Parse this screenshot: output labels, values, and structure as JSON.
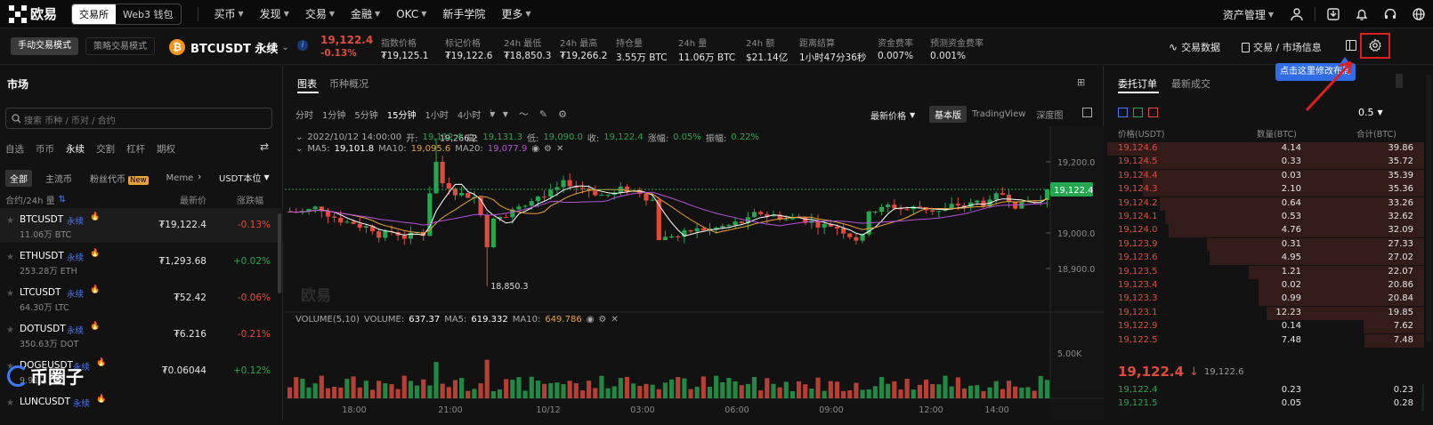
{
  "app": {
    "logo_text": "欧易"
  },
  "topnav": {
    "seg": [
      "交易所",
      "Web3 钱包"
    ],
    "items": [
      {
        "label": "买币",
        "caret": true
      },
      {
        "label": "发现",
        "caret": true
      },
      {
        "label": "交易",
        "caret": true
      },
      {
        "label": "金融",
        "caret": true
      },
      {
        "label": "OKC",
        "caret": true
      },
      {
        "label": "新手学院",
        "caret": false
      },
      {
        "label": "更多",
        "caret": true
      }
    ],
    "asset_mgmt": "资产管理"
  },
  "ticker": {
    "mode_manual": "手动交易模式",
    "mode_strategy": "策略交易模式",
    "symbol": "BTCUSDT 永续",
    "price": "19,122.4",
    "change": "-0.13%",
    "stats": [
      {
        "label": "指数价格",
        "value": "₮19,125.1"
      },
      {
        "label": "标记价格",
        "value": "₮19,122.6"
      },
      {
        "label": "24h 最低",
        "value": "₮18,850.3"
      },
      {
        "label": "24h 最高",
        "value": "₮19,266.2"
      },
      {
        "label": "持仓量",
        "value": "3.55万 BTC"
      },
      {
        "label": "24h 量",
        "value": "11.06万 BTC"
      },
      {
        "label": "24h 额",
        "value": "$21.14亿"
      },
      {
        "label": "距离结算",
        "value": "1小时47分36秒"
      },
      {
        "label": "资金费率",
        "value": "0.007%"
      },
      {
        "label": "预测资金费率",
        "value": "0.001%"
      }
    ],
    "trade_data": "交易数据",
    "market_info": "交易 / 市场信息",
    "tooltip": "点击这里修改布局"
  },
  "market": {
    "title": "市场",
    "search_placeholder": "搜索 币种 / 币对 / 合约",
    "tabs": [
      "自选",
      "币币",
      "永续",
      "交割",
      "杠杆",
      "期权"
    ],
    "filters": [
      "全部",
      "主流币",
      "粉丝代币",
      "Meme"
    ],
    "new_badge": "New",
    "unit": "USDT本位",
    "col_contract": "合约/24h 量",
    "col_price": "最新价",
    "col_change": "涨跌幅",
    "perp_tag": "永续",
    "rows": [
      {
        "symbol": "BTCUSDT",
        "vol": "11.06万 BTC",
        "price": "₮19,122.4",
        "change": "-0.13%",
        "up": false
      },
      {
        "symbol": "ETHUSDT",
        "vol": "253.28万 ETH",
        "price": "₮1,293.68",
        "change": "+0.02%",
        "up": true
      },
      {
        "symbol": "LTCUSDT",
        "vol": "64.30万 LTC",
        "price": "₮52.42",
        "change": "-0.06%",
        "up": false
      },
      {
        "symbol": "DOTUSDT",
        "vol": "350.63万 DOT",
        "price": "₮6.216",
        "change": "-0.21%",
        "up": false
      },
      {
        "symbol": "DOGEUSDT",
        "vol": "9.91亿",
        "price": "₮0.06044",
        "change": "+0.12%",
        "up": true
      },
      {
        "symbol": "LUNCUSDT",
        "vol": "",
        "price": "",
        "change": "",
        "up": false
      }
    ],
    "watermark": "币圈子"
  },
  "chart": {
    "tabs": [
      "图表",
      "币种概况"
    ],
    "intervals": [
      "分时",
      "1分钟",
      "5分钟",
      "15分钟",
      "1小时",
      "4小时"
    ],
    "active_interval": "15分钟",
    "price_type": "最新价格",
    "views": [
      "基本版",
      "TradingView",
      "深度图"
    ],
    "ohlc": {
      "date": "2022/10/12 14:00:00",
      "open_l": "开:",
      "open": "19,112.4",
      "high_l": "高:",
      "high": "19,131.3",
      "low_l": "低:",
      "low": "19,090.0",
      "close_l": "收:",
      "close": "19,122.4",
      "chg_l": "涨幅:",
      "chg": "0.05%",
      "amp_l": "振幅:",
      "amp": "0.22%"
    },
    "ma": {
      "ma5_l": "MA5:",
      "ma5": "19,101.8",
      "ma10_l": "MA10:",
      "ma10": "19,095.6",
      "ma20_l": "MA20:",
      "ma20": "19,077.9"
    },
    "high_mark": "19,266.2",
    "low_mark": "18,850.3",
    "y_ticks": [
      "19,200.0",
      "19,000.0",
      "18,900.0"
    ],
    "last_price": "19,122.4",
    "watermark": "欧易",
    "vol": {
      "label": "VOLUME(5,10)",
      "vol_l": "VOLUME:",
      "vol": "637.37",
      "ma5_l": "MA5:",
      "ma5": "619.332",
      "ma10_l": "MA10:",
      "ma10": "649.786",
      "tick": "5.00K"
    },
    "x_ticks": [
      "18:00",
      "21:00",
      "10/12",
      "03:00",
      "06:00",
      "09:00",
      "12:00",
      "14:00"
    ],
    "colors": {
      "up": "#25a750",
      "down": "#e24b3c",
      "ma5": "#ffffff",
      "ma10": "#e7a23a",
      "ma20": "#b552d8"
    }
  },
  "chart_data": {
    "type": "candlestick",
    "title": "",
    "ylim": [
      18800,
      19300
    ],
    "series": [
      {
        "name": "MA5",
        "value": 19101.8
      },
      {
        "name": "MA10",
        "value": 19095.6
      },
      {
        "name": "MA20",
        "value": 19077.9
      }
    ],
    "last": 19122.4,
    "high": 19266.2,
    "low": 18850.3,
    "volume_axis_tick": 5000
  },
  "orderbook": {
    "tabs": [
      "委托订单",
      "最新成交"
    ],
    "precision": "0.5",
    "headers": [
      "价格(USDT)",
      "数量(BTC)",
      "合计(BTC)"
    ],
    "asks": [
      [
        "19,124.6",
        "4.14",
        "39.86"
      ],
      [
        "19,124.5",
        "0.33",
        "35.72"
      ],
      [
        "19,124.4",
        "0.03",
        "35.39"
      ],
      [
        "19,124.3",
        "2.10",
        "35.36"
      ],
      [
        "19,124.2",
        "0.64",
        "33.26"
      ],
      [
        "19,124.1",
        "0.53",
        "32.62"
      ],
      [
        "19,124.0",
        "4.76",
        "32.09"
      ],
      [
        "19,123.9",
        "0.31",
        "27.33"
      ],
      [
        "19,123.6",
        "4.95",
        "27.02"
      ],
      [
        "19,123.5",
        "1.21",
        "22.07"
      ],
      [
        "19,123.4",
        "0.02",
        "20.86"
      ],
      [
        "19,123.3",
        "0.99",
        "20.84"
      ],
      [
        "19,123.1",
        "12.23",
        "19.85"
      ],
      [
        "19,122.9",
        "0.14",
        "7.62"
      ],
      [
        "19,122.5",
        "7.48",
        "7.48"
      ]
    ],
    "mid_price": "19,122.4",
    "mid_arrow": "↓",
    "mid_mark": "19,122.6",
    "bids": [
      [
        "19,122.4",
        "0.23",
        "0.23"
      ],
      [
        "19,121.5",
        "0.05",
        "0.28"
      ]
    ]
  }
}
